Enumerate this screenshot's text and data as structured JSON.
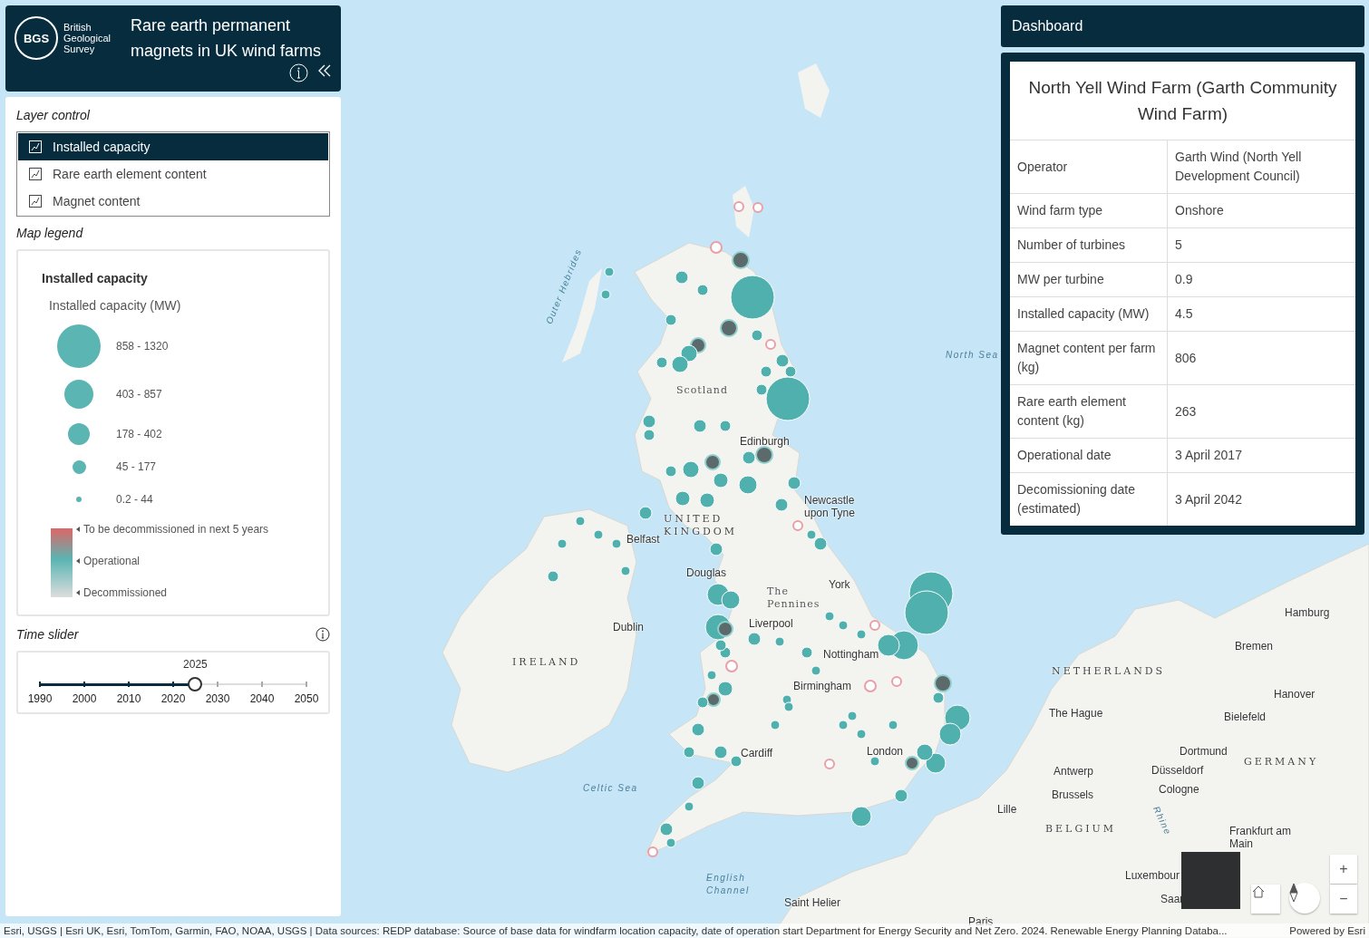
{
  "header": {
    "logo_text": "BGS",
    "org_name": "British Geological Survey",
    "title": "Rare earth permanent magnets in UK wind farms"
  },
  "layer_control": {
    "title": "Layer control",
    "items": [
      {
        "label": "Installed capacity",
        "selected": true
      },
      {
        "label": "Rare earth element content",
        "selected": false
      },
      {
        "label": "Magnet content",
        "selected": false
      }
    ]
  },
  "legend": {
    "title": "Map legend",
    "heading": "Installed capacity",
    "subheading": "Installed capacity (MW)",
    "sizes": [
      {
        "label": "858 - 1320"
      },
      {
        "label": "403 - 857"
      },
      {
        "label": "178 - 402"
      },
      {
        "label": "45 - 177"
      },
      {
        "label": "0.2 - 44"
      }
    ],
    "status_ramp": [
      {
        "label": "To be decommissioned in next 5 years"
      },
      {
        "label": "Operational"
      },
      {
        "label": "Decommissioned"
      }
    ]
  },
  "time_slider": {
    "title": "Time slider",
    "value_label": "2025",
    "level": 0.583,
    "ticks": [
      "1990",
      "2000",
      "2010",
      "2020",
      "2030",
      "2040",
      "2050"
    ]
  },
  "dashboard": {
    "title": "Dashboard",
    "farm_name": "North Yell Wind Farm (Garth Community Wind Farm)",
    "rows": [
      {
        "label": "Operator",
        "value": "Garth Wind (North Yell Development Council)"
      },
      {
        "label": "Wind farm type",
        "value": "Onshore"
      },
      {
        "label": "Number of turbines",
        "value": "5"
      },
      {
        "label": "MW per turbine",
        "value": "0.9"
      },
      {
        "label": "Installed capacity (MW)",
        "value": "4.5"
      },
      {
        "label": "Magnet content per farm (kg)",
        "value": "806"
      },
      {
        "label": "Rare earth element content (kg)",
        "value": "263"
      },
      {
        "label": "Operational date",
        "value": "3 April 2017"
      },
      {
        "label": "Decomissioning date (estimated)",
        "value": "3 April 2042"
      }
    ]
  },
  "map": {
    "labels": [
      {
        "text": "Outer Hebrides",
        "kind": "sea"
      },
      {
        "text": "Scotland",
        "kind": "region"
      },
      {
        "text": "North Sea",
        "kind": "sea"
      },
      {
        "text": "Edinburgh",
        "kind": "city"
      },
      {
        "text": "Newcastle upon Tyne",
        "kind": "city"
      },
      {
        "text": "UNITED KINGDOM",
        "kind": "country"
      },
      {
        "text": "Belfast",
        "kind": "city"
      },
      {
        "text": "Douglas",
        "kind": "city"
      },
      {
        "text": "York",
        "kind": "city"
      },
      {
        "text": "The Pennines",
        "kind": "region"
      },
      {
        "text": "Liverpool",
        "kind": "city"
      },
      {
        "text": "Dublin",
        "kind": "city"
      },
      {
        "text": "IRELAND",
        "kind": "country"
      },
      {
        "text": "Nottingham",
        "kind": "city"
      },
      {
        "text": "Birmingham",
        "kind": "city"
      },
      {
        "text": "Cardiff",
        "kind": "city"
      },
      {
        "text": "London",
        "kind": "city"
      },
      {
        "text": "Celtic Sea",
        "kind": "sea"
      },
      {
        "text": "English Channel",
        "kind": "sea"
      },
      {
        "text": "Saint Helier",
        "kind": "city"
      },
      {
        "text": "Paris",
        "kind": "city"
      },
      {
        "text": "Hamburg",
        "kind": "city"
      },
      {
        "text": "Bremen",
        "kind": "city"
      },
      {
        "text": "NETHERLANDS",
        "kind": "country"
      },
      {
        "text": "Hanover",
        "kind": "city"
      },
      {
        "text": "The Hague",
        "kind": "city"
      },
      {
        "text": "Bielefeld",
        "kind": "city"
      },
      {
        "text": "Dortmund",
        "kind": "city"
      },
      {
        "text": "GERMANY",
        "kind": "country"
      },
      {
        "text": "Antwerp",
        "kind": "city"
      },
      {
        "text": "Düsseldorf",
        "kind": "city"
      },
      {
        "text": "Brussels",
        "kind": "city"
      },
      {
        "text": "Cologne",
        "kind": "city"
      },
      {
        "text": "Lille",
        "kind": "city"
      },
      {
        "text": "BELGIUM",
        "kind": "country"
      },
      {
        "text": "Rhine",
        "kind": "sea"
      },
      {
        "text": "Frankfurt am Main",
        "kind": "city"
      },
      {
        "text": "Luxembour",
        "kind": "city"
      },
      {
        "text": "Saar",
        "kind": "city"
      }
    ]
  },
  "map_controls": {
    "zoom_in": "+",
    "zoom_out": "−"
  },
  "attribution": {
    "text": "Esri, USGS | Esri UK, Esri, TomTom, Garmin, FAO, NOAA, USGS | Data sources: REDP database: Source of base data for windfarm location capacity, date of operation start Department for Energy Security and Net Zero. 2024. Renewable Energy Planning Databa...",
    "powered_by": "Powered by Esri"
  }
}
